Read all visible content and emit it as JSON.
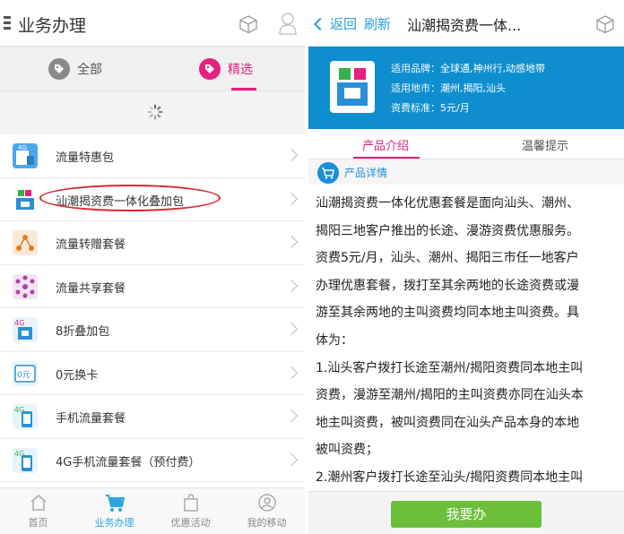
{
  "left": {
    "title": "业务办理",
    "tabs": [
      {
        "label": "全部",
        "icon": "tag-icon"
      },
      {
        "label": "精选",
        "icon": "tag-icon"
      }
    ],
    "items": [
      {
        "label": "流量特惠包",
        "icon_text": "4G"
      },
      {
        "label": "汕潮揭资费一体化叠加包",
        "icon_text": ""
      },
      {
        "label": "流量转赠套餐",
        "icon_text": ""
      },
      {
        "label": "流量共享套餐",
        "icon_text": ""
      },
      {
        "label": "8折叠加包",
        "icon_text": "4G"
      },
      {
        "label": "0元换卡",
        "icon_text": "0元"
      },
      {
        "label": "手机流量套餐",
        "icon_text": "4G"
      },
      {
        "label": "4G手机流量套餐（预付费）",
        "icon_text": "4G"
      },
      {
        "label": "",
        "icon_text": ""
      }
    ],
    "nav": [
      {
        "label": "首页"
      },
      {
        "label": "业务办理"
      },
      {
        "label": "优惠活动"
      },
      {
        "label": "我的移动"
      }
    ]
  },
  "right": {
    "back_label": "返回",
    "refresh_label": "刷新",
    "title": "汕潮揭资费一体...",
    "brand_key": "适用品牌：",
    "brand_val": "全球通,神州行,动感地带",
    "region_key": "适用地市：",
    "region_val": "潮州,揭阳,汕头",
    "fee_key": "资费标准：",
    "fee_val": "5元/月",
    "tab_intro": "产品介绍",
    "tab_tips": "温馨提示",
    "detail_title": "产品详情",
    "lines": [
      "汕潮揭资费一体化优惠套餐是面向汕头、潮州、",
      "揭阳三地客户推出的长途、漫游资费优惠服务。",
      "资费5元/月，汕头、潮州、揭阳三市任一地客户",
      "办理优惠套餐，拨打至其余两地的长途资费或漫",
      "游至其余两地的主叫资费均同本地主叫资费。具",
      "体为：",
      "1.汕头客户拨打长途至潮州/揭阳资费同本地主叫",
      "资费，漫游至潮州/揭阳的主叫资费亦同在汕头本",
      "地主叫资费，被叫资费同在汕头产品本身的本地",
      "被叫资费；",
      "2.潮州客户拨打长途至汕头/揭阳资费同本地主叫"
    ],
    "cta_label": "我要办"
  },
  "colors": {
    "accent_pink": "#e0207a",
    "accent_blue": "#1c8fd6",
    "banner_blue": "#0e8ecf",
    "cta_green": "#6cbf3a",
    "annotation_red": "#d8262e"
  }
}
